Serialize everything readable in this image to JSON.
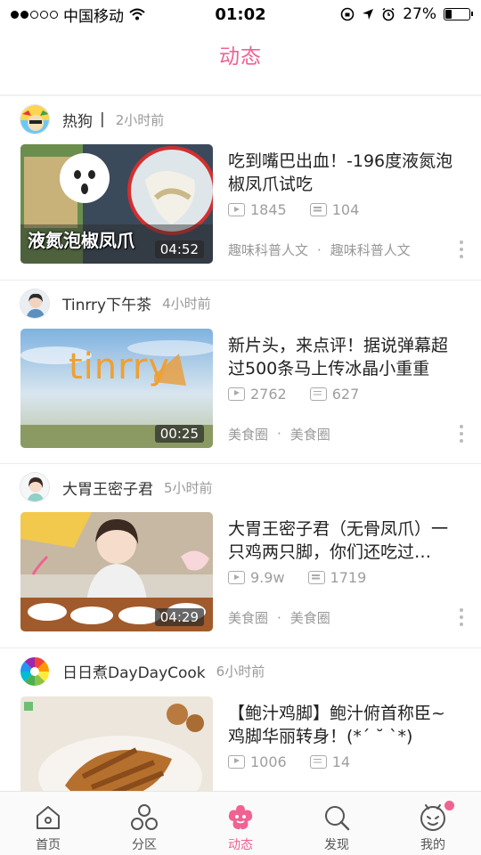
{
  "status_bar": {
    "carrier": "中国移动",
    "time": "01:02",
    "battery": "27%",
    "battery_level": 0.27
  },
  "nav": {
    "title": "动态"
  },
  "feed": [
    {
      "author": "热狗",
      "author_suffix": "|",
      "time_ago": "2小时前",
      "title": "吃到嘴巴出血！-196度液氮泡椒凤爪试吃",
      "plays": "1845",
      "danmaku": "104",
      "tag1": "趣味科普人文",
      "tag2": "趣味科普人文",
      "duration": "04:52",
      "thumb_text": "液氮泡椒凤爪"
    },
    {
      "author": "Tinrry下午茶",
      "time_ago": "4小时前",
      "title": "新片头，来点评！据说弹幕超过500条马上传冰晶小重重",
      "plays": "2762",
      "danmaku": "627",
      "tag1": "美食圈",
      "tag2": "美食圈",
      "duration": "00:25",
      "thumb_text": "tinrry"
    },
    {
      "author": "大胃王密子君",
      "time_ago": "5小时前",
      "title": "大胃王密子君（无骨凤爪）一只鸡两只脚，你们还吃过…",
      "plays": "9.9w",
      "danmaku": "1719",
      "tag1": "美食圈",
      "tag2": "美食圈",
      "duration": "04:29"
    },
    {
      "author": "日日煮DayDayCook",
      "time_ago": "6小时前",
      "title": "【鲍汁鸡脚】鲍汁俯首称臣~鸡脚华丽转身！(*´ ˘ `*)",
      "plays": "1006",
      "danmaku": "14"
    }
  ],
  "tabs": [
    {
      "label": "首页",
      "icon": "home-icon"
    },
    {
      "label": "分区",
      "icon": "category-icon"
    },
    {
      "label": "动态",
      "icon": "dynamic-icon",
      "active": true
    },
    {
      "label": "发现",
      "icon": "search-icon"
    },
    {
      "label": "我的",
      "icon": "profile-icon"
    }
  ],
  "colors": {
    "accent": "#f06292",
    "muted": "#999999"
  }
}
